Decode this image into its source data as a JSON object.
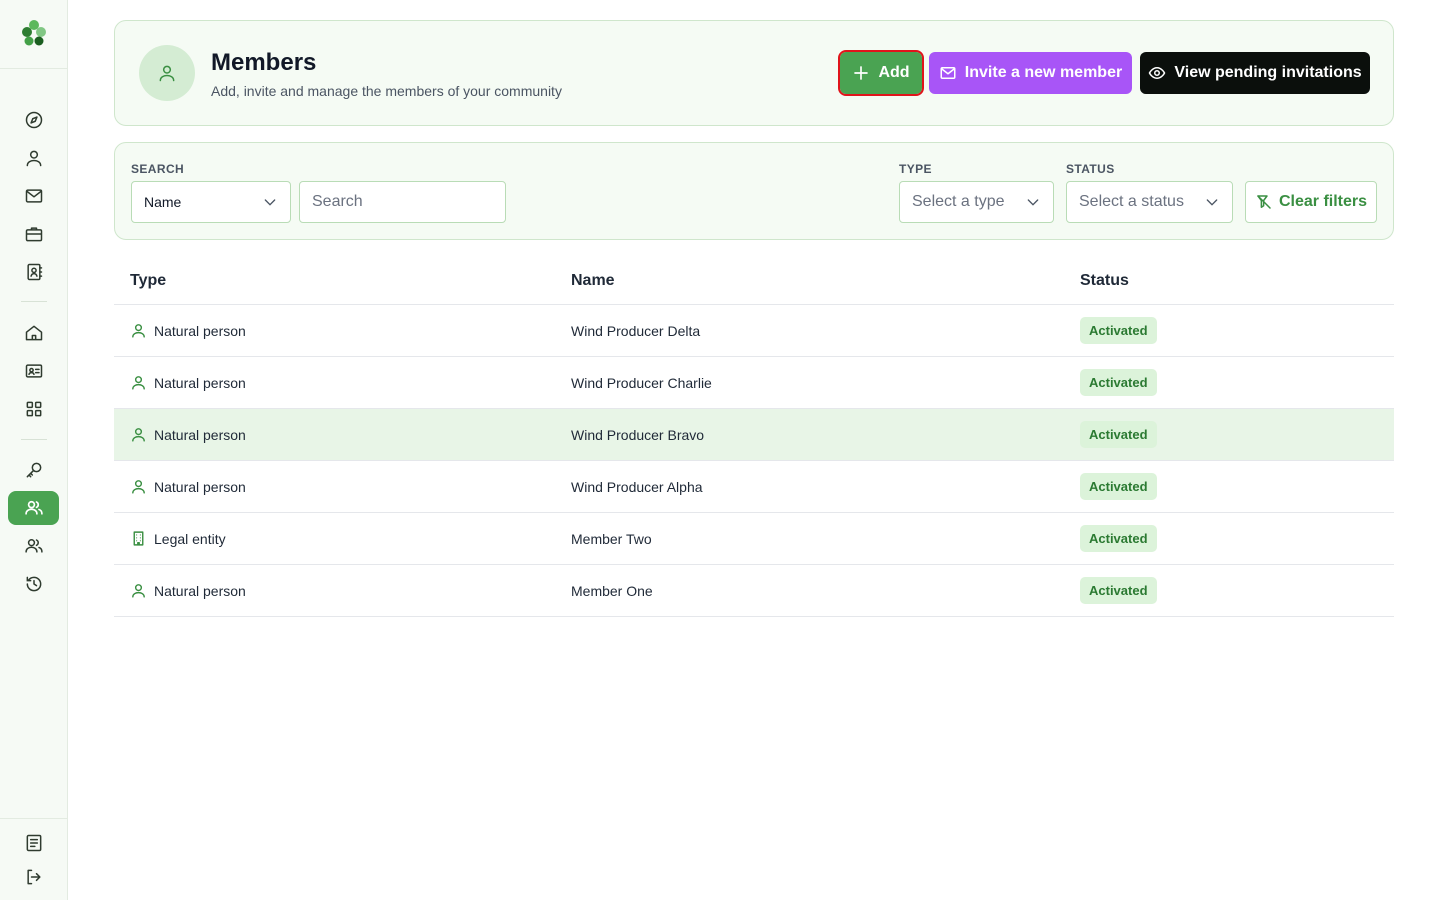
{
  "header": {
    "title": "Members",
    "subtitle": "Add, invite and manage the members of your community",
    "add_label": "Add",
    "invite_label": "Invite a new member",
    "pending_label": "View pending invitations"
  },
  "filters": {
    "search_label": "SEARCH",
    "search_field_value": "Name",
    "search_placeholder": "Search",
    "type_label": "TYPE",
    "type_placeholder": "Select a type",
    "status_label": "STATUS",
    "status_placeholder": "Select a status",
    "clear_label": "Clear filters"
  },
  "table": {
    "columns": [
      "Type",
      "Name",
      "Status"
    ],
    "rows": [
      {
        "type": "Natural person",
        "type_icon": "person-icon",
        "name": "Wind Producer Delta",
        "status": "Activated"
      },
      {
        "type": "Natural person",
        "type_icon": "person-icon",
        "name": "Wind Producer Charlie",
        "status": "Activated"
      },
      {
        "type": "Natural person",
        "type_icon": "person-icon",
        "name": "Wind Producer Bravo",
        "status": "Activated"
      },
      {
        "type": "Natural person",
        "type_icon": "person-icon",
        "name": "Wind Producer Alpha",
        "status": "Activated"
      },
      {
        "type": "Legal entity",
        "type_icon": "building-icon",
        "name": "Member Two",
        "status": "Activated"
      },
      {
        "type": "Natural person",
        "type_icon": "person-icon",
        "name": "Member One",
        "status": "Activated"
      }
    ]
  },
  "sidebar": {
    "items": [
      "compass-icon",
      "user-icon",
      "mail-icon",
      "briefcase-icon",
      "contacts-icon",
      "home-icon",
      "id-card-icon",
      "grid-icon",
      "key-icon",
      "members-icon",
      "group-icon",
      "history-icon"
    ],
    "active_item": "members-icon",
    "bottom_items": [
      "document-icon",
      "logout-icon"
    ]
  },
  "colors": {
    "accent": "#4aa352",
    "invite": "#a855f7",
    "pending": "#0b0f0c",
    "badge_bg": "#dcf3da",
    "badge_text": "#2b7a32",
    "highlight_row": "#e8f5e7"
  }
}
